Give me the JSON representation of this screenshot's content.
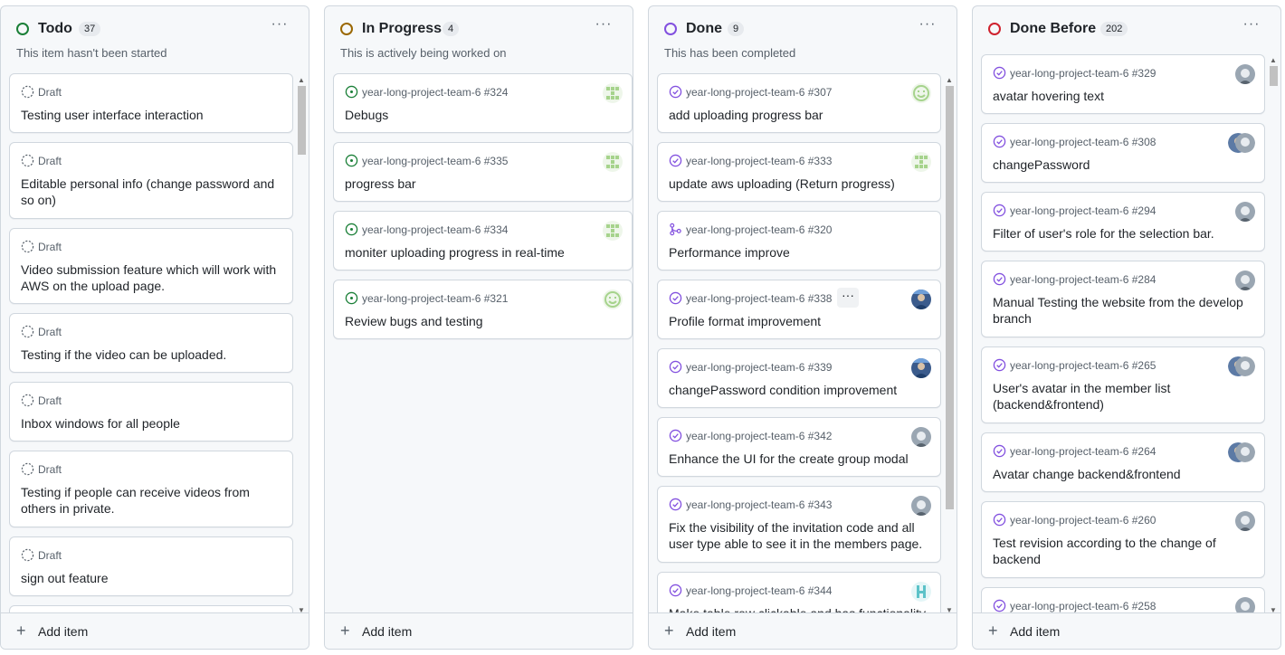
{
  "columns": [
    {
      "title": "Todo",
      "count": "37",
      "description": "This item hasn't been started",
      "status_color": "#1a7f37",
      "menu_glyph": "···",
      "add_label": "Add item",
      "cards": [
        {
          "meta": "Draft",
          "title": "Testing user interface interaction",
          "kind": "draft"
        },
        {
          "meta": "Draft",
          "title": "Editable personal info (change password and so on)",
          "kind": "draft"
        },
        {
          "meta": "Draft",
          "title": "Video submission feature which will work with AWS on the upload page.",
          "kind": "draft"
        },
        {
          "meta": "Draft",
          "title": "Testing if the video can be uploaded.",
          "kind": "draft"
        },
        {
          "meta": "Draft",
          "title": "Inbox windows for all people",
          "kind": "draft"
        },
        {
          "meta": "Draft",
          "title": "Testing if people can receive videos from others in private.",
          "kind": "draft"
        },
        {
          "meta": "Draft",
          "title": "sign out feature",
          "kind": "draft"
        },
        {
          "meta": "",
          "title": "",
          "kind": "draft"
        }
      ]
    },
    {
      "title": "In Progress",
      "count": "4",
      "description": "This is actively being worked on",
      "status_color": "#9a6700",
      "menu_glyph": "···",
      "add_label": "Add item",
      "cards": [
        {
          "meta": "year-long-project-team-6 #324",
          "title": "Debugs",
          "kind": "open",
          "avatar": "identicon"
        },
        {
          "meta": "year-long-project-team-6 #335",
          "title": "progress bar",
          "kind": "open",
          "avatar": "identicon"
        },
        {
          "meta": "year-long-project-team-6 #334",
          "title": "moniter uploading progress in real-time",
          "kind": "open",
          "avatar": "identicon"
        },
        {
          "meta": "year-long-project-team-6 #321",
          "title": "Review bugs and testing",
          "kind": "open",
          "avatar": "identicon-face"
        }
      ]
    },
    {
      "title": "Done",
      "count": "9",
      "description": "This has been completed",
      "status_color": "#8250df",
      "menu_glyph": "···",
      "add_label": "Add item",
      "cards": [
        {
          "meta": "year-long-project-team-6 #307",
          "title": "add uploading progress bar",
          "kind": "closed",
          "avatar": "identicon-face"
        },
        {
          "meta": "year-long-project-team-6 #333",
          "title": "update aws uploading (Return progress)",
          "kind": "closed",
          "avatar": "identicon"
        },
        {
          "meta": "year-long-project-team-6 #320",
          "title": "Performance improve",
          "kind": "merged"
        },
        {
          "meta": "year-long-project-team-6 #338",
          "title": "Profile format improvement",
          "kind": "closed",
          "avatar": "photo-blue",
          "more": "···"
        },
        {
          "meta": "year-long-project-team-6 #339",
          "title": "changePassword condition improvement",
          "kind": "closed",
          "avatar": "photo-blue"
        },
        {
          "meta": "year-long-project-team-6 #342",
          "title": "Enhance the UI for the create group modal",
          "kind": "closed",
          "avatar": "photo-grey"
        },
        {
          "meta": "year-long-project-team-6 #343",
          "title": "Fix the visibility of the invitation code and all user type able to see it in the members page.",
          "kind": "closed",
          "avatar": "photo-grey"
        },
        {
          "meta": "year-long-project-team-6 #344",
          "title": "Make table row clickable and has functionality",
          "kind": "closed",
          "avatar": "identicon-teal"
        }
      ]
    },
    {
      "title": "Done Before",
      "count": "202",
      "description": "",
      "status_color": "#cf222e",
      "menu_glyph": "···",
      "add_label": "Add item",
      "cards": [
        {
          "meta": "year-long-project-team-6 #329",
          "title": "avatar hovering text",
          "kind": "closed",
          "avatar": "photo-grey"
        },
        {
          "meta": "year-long-project-team-6 #308",
          "title": "changePassword",
          "kind": "closed",
          "avatar": "photo-pair"
        },
        {
          "meta": "year-long-project-team-6 #294",
          "title": "Filter of user's role for the selection bar.",
          "kind": "closed",
          "avatar": "photo-grey"
        },
        {
          "meta": "year-long-project-team-6 #284",
          "title": "Manual Testing the website from the develop branch",
          "kind": "closed",
          "avatar": "photo-grey"
        },
        {
          "meta": "year-long-project-team-6 #265",
          "title": "User's avatar in the member list (backend&frontend)",
          "kind": "closed",
          "avatar": "photo-pair"
        },
        {
          "meta": "year-long-project-team-6 #264",
          "title": "Avatar change backend&frontend",
          "kind": "closed",
          "avatar": "photo-pair"
        },
        {
          "meta": "year-long-project-team-6 #260",
          "title": "Test revision according to the change of backend",
          "kind": "closed",
          "avatar": "photo-grey"
        },
        {
          "meta": "year-long-project-team-6 #258",
          "title": "",
          "kind": "closed",
          "avatar": "photo-grey"
        }
      ]
    }
  ]
}
